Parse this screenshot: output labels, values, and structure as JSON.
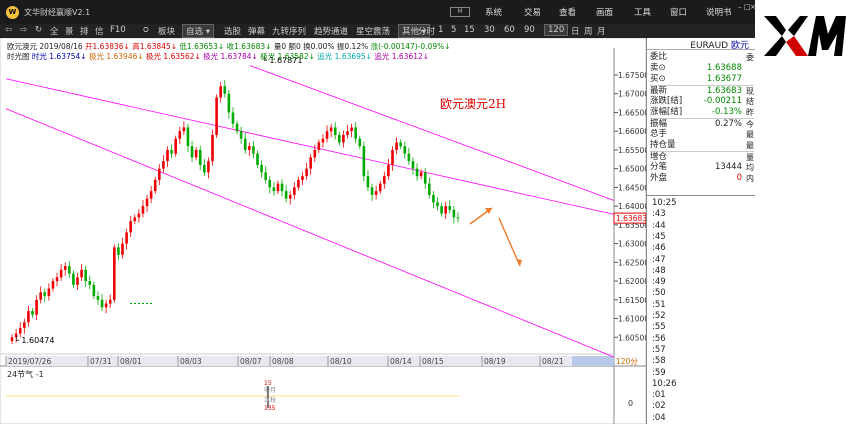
{
  "app": {
    "title": "文华财经赢顺V2.1",
    "logo": "W",
    "badge": "M"
  },
  "menu": [
    "系统",
    "交易",
    "查看",
    "画面",
    "工具",
    "窗口",
    "说明书"
  ],
  "toolbar": {
    "items": [
      "⇦",
      "⇨",
      "↻",
      "全",
      "景",
      "排",
      "信",
      "F10",
      "ᴑ",
      "板块"
    ],
    "selected": "自选",
    "more": [
      "选股",
      "弹幕",
      "九转序列",
      "趋势通道",
      "星空震荡"
    ],
    "other": "其他",
    "periods": [
      "分时",
      "1",
      "5",
      "15",
      "30",
      "60",
      "90",
      "120",
      "日",
      "周",
      "月"
    ],
    "active_period": "120"
  },
  "info": {
    "symbol": "欧元澳元 2019/08/16",
    "open": "开1.63836↓",
    "high": "高1.63845↓",
    "low": "低1.63653↓",
    "close": "收1.63683↓",
    "vol": "量0",
    "amt": "额0",
    "chg": "换0.00%",
    "amp": "振0.12%",
    "rise": "涨(-0.00147)-0.09%↓",
    "line2_prefix": "时光图",
    "l1": "时光 1.63754↓",
    "l2": "极光 1.63946↓",
    "l3": "极光 1.63562↓",
    "l4": "极光 1.63784↓",
    "l5": "极光 1.63582↓",
    "l6": "追光 1.63695↓",
    "l7": "追光 1.63612↓"
  },
  "chart_data": {
    "type": "candlestick",
    "title": "欧元澳元2H",
    "symbol": "EURAUD",
    "ylim": [
      1.6,
      1.679
    ],
    "yticks": [
      "1.67500",
      "1.67000",
      "1.66500",
      "1.66000",
      "1.65500",
      "1.65000",
      "1.64500",
      "1.64000",
      "1.63500",
      "1.63000",
      "1.62500",
      "1.62000",
      "1.61500",
      "1.61000",
      "1.60500"
    ],
    "xlabels": [
      "2019/07/26",
      "07/31",
      "08/01",
      "08/03",
      "08/07",
      "08/08",
      "08/10",
      "08/14",
      "08/15",
      "08/19",
      "08/21"
    ],
    "high_label": "1.67871",
    "low_label": "1.60474",
    "last_price": "1.63683",
    "period_label": "120分",
    "close": [
      1.605,
      1.606,
      1.6075,
      1.609,
      1.612,
      1.611,
      1.615,
      1.617,
      1.616,
      1.618,
      1.62,
      1.621,
      1.623,
      1.624,
      1.622,
      1.619,
      1.621,
      1.623,
      1.62,
      1.619,
      1.616,
      1.615,
      1.613,
      1.614,
      1.615,
      1.629,
      1.627,
      1.63,
      1.633,
      1.636,
      1.637,
      1.638,
      1.64,
      1.642,
      1.644,
      1.647,
      1.65,
      1.652,
      1.655,
      1.654,
      1.658,
      1.66,
      1.661,
      1.656,
      1.653,
      1.655,
      1.651,
      1.649,
      1.652,
      1.659,
      1.669,
      1.672,
      1.67,
      1.665,
      1.662,
      1.66,
      1.658,
      1.655,
      1.656,
      1.654,
      1.651,
      1.649,
      1.647,
      1.645,
      1.644,
      1.646,
      1.644,
      1.642,
      1.643,
      1.645,
      1.647,
      1.648,
      1.65,
      1.653,
      1.655,
      1.657,
      1.658,
      1.66,
      1.661,
      1.659,
      1.657,
      1.659,
      1.66,
      1.661,
      1.658,
      1.656,
      1.648,
      1.645,
      1.643,
      1.644,
      1.646,
      1.648,
      1.651,
      1.655,
      1.657,
      1.656,
      1.654,
      1.652,
      1.65,
      1.648,
      1.649,
      1.646,
      1.643,
      1.641,
      1.64,
      1.638,
      1.64,
      1.639,
      1.637,
      1.6368
    ],
    "forecast": "up then down"
  },
  "indicator": {
    "name": "24节气",
    "value": "-1",
    "mark_top": "15",
    "mark_mid": "申月",
    "mark_bot": "135",
    "mark_label": "立秋",
    "zero": "0"
  },
  "panel": {
    "symbol": "EURAUD",
    "symbol_suffix": "欧元",
    "rows": [
      {
        "k": "委比",
        "v": "",
        "x": "委"
      },
      {
        "k": "卖⊙",
        "v": "1.63688",
        "x": "",
        "vc": "g"
      },
      {
        "k": "买⊙",
        "v": "1.63677",
        "x": "",
        "vc": "g"
      },
      {
        "k": "最新",
        "v": "1.63683",
        "x": "现",
        "vc": "g"
      },
      {
        "k": "涨跌[结]",
        "v": "-0.00211",
        "x": "结",
        "vc": "g"
      },
      {
        "k": "涨幅[结]",
        "v": "-0.13%",
        "x": "昨",
        "vc": "g"
      },
      {
        "k": "振幅",
        "v": "0.27%",
        "x": "今"
      },
      {
        "k": "总手",
        "v": "",
        "x": "最"
      },
      {
        "k": "持仓量",
        "v": "",
        "x": "最"
      },
      {
        "k": "增仓",
        "v": "",
        "x": "量"
      },
      {
        "k": "分笔",
        "v": "13444",
        "x": "均"
      },
      {
        "k": "外盘",
        "v": "0",
        "x": "内",
        "vc": "r"
      }
    ],
    "ticks": [
      "10:25",
      ":43",
      ":44",
      ":45",
      ":46",
      ":47",
      ":48",
      ":49",
      ":50",
      ":51",
      ":52",
      ":55",
      ":56",
      ":57",
      ":58",
      ":59",
      "10:26",
      ":01",
      ":02",
      ":04"
    ]
  },
  "brand": {
    "logo": "XM",
    "color": "#000000",
    "accent": "#d10000"
  }
}
